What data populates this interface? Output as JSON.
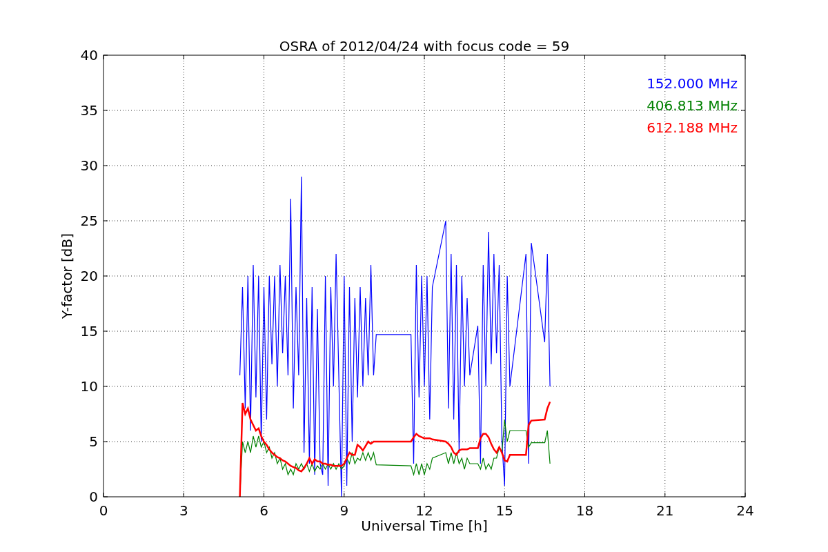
{
  "figure": {
    "chart_data": {
      "type": "line",
      "title": "OSRA of 2012/04/24 with focus code = 59",
      "xlabel": "Universal Time [h]",
      "ylabel": "Y-factor [dB]",
      "xlim": [
        0,
        24
      ],
      "ylim": [
        0,
        40
      ],
      "xticks": [
        0,
        3,
        6,
        9,
        12,
        15,
        18,
        21,
        24
      ],
      "yticks": [
        0,
        5,
        10,
        15,
        20,
        25,
        30,
        35,
        40
      ],
      "grid": true,
      "x": [
        5.1,
        5.2,
        5.3,
        5.4,
        5.5,
        5.6,
        5.7,
        5.8,
        5.9,
        6.0,
        6.1,
        6.2,
        6.3,
        6.4,
        6.5,
        6.6,
        6.7,
        6.8,
        6.9,
        7.0,
        7.1,
        7.2,
        7.3,
        7.4,
        7.5,
        7.6,
        7.7,
        7.8,
        7.9,
        8.0,
        8.1,
        8.2,
        8.3,
        8.4,
        8.5,
        8.6,
        8.7,
        8.8,
        8.9,
        9.0,
        9.1,
        9.2,
        9.3,
        9.4,
        9.5,
        9.6,
        9.7,
        9.8,
        9.9,
        10.0,
        10.1,
        10.2,
        11.5,
        11.6,
        11.7,
        11.8,
        11.9,
        12.0,
        12.1,
        12.2,
        12.3,
        12.8,
        12.9,
        13.0,
        13.1,
        13.2,
        13.3,
        13.4,
        13.5,
        13.6,
        13.7,
        14.0,
        14.1,
        14.2,
        14.3,
        14.4,
        14.5,
        14.6,
        14.7,
        14.8,
        14.9,
        15.0,
        15.1,
        15.2,
        15.8,
        15.9,
        16.0,
        16.5,
        16.6,
        16.7
      ],
      "series": [
        {
          "name": "152.000 MHz",
          "color": "#0000ff",
          "values": [
            11,
            19,
            8,
            20,
            6,
            21,
            9,
            20,
            5,
            19,
            7,
            20,
            12,
            20,
            10,
            21,
            13,
            20,
            11,
            27,
            8,
            19,
            11,
            29,
            4,
            18,
            3,
            19,
            2,
            17,
            3,
            2,
            20,
            1,
            19,
            10,
            22,
            11,
            0,
            20,
            1,
            19,
            5,
            18,
            9,
            19,
            10,
            18,
            11,
            21,
            11,
            14.7,
            14.7,
            3,
            21,
            9,
            20,
            10,
            20,
            7,
            19,
            25,
            8,
            22,
            7,
            21,
            4,
            20,
            10,
            18,
            11,
            15.5,
            3,
            21,
            10,
            24,
            12,
            22,
            13,
            21,
            5,
            1,
            20,
            10,
            22,
            3,
            23,
            14,
            22,
            10
          ]
        },
        {
          "name": "406.813 MHz",
          "color": "#008000",
          "values": [
            0,
            5,
            4,
            5,
            4,
            5.5,
            4.5,
            5.5,
            4.5,
            5,
            4,
            4.5,
            3.5,
            4,
            3,
            3.5,
            2.5,
            3,
            2,
            2.5,
            2,
            3,
            2.5,
            3,
            2.5,
            3,
            2.3,
            3,
            2.3,
            2.8,
            2.5,
            3,
            2.5,
            3,
            2.5,
            3,
            2.5,
            3,
            2.5,
            2.8,
            3.5,
            3,
            4,
            3,
            3.5,
            3.3,
            4,
            3.3,
            4,
            3.3,
            4,
            2.9,
            2.8,
            2,
            3,
            2,
            3,
            2,
            3,
            2.5,
            3.5,
            4,
            3,
            4,
            3,
            4,
            3,
            3.5,
            2.5,
            3.5,
            3,
            3,
            2.5,
            3.5,
            2.5,
            3,
            2.5,
            3.5,
            3.5,
            4.5,
            4,
            7,
            5,
            6,
            6,
            4.5,
            4.9,
            4.9,
            6,
            3
          ]
        },
        {
          "name": "612.188 MHz",
          "color": "#ff0000",
          "values": [
            0,
            8.5,
            7.5,
            8,
            7,
            6.5,
            6,
            6.2,
            5.5,
            5,
            4.7,
            4.3,
            4,
            3.8,
            3.6,
            3.5,
            3.3,
            3.2,
            3,
            2.8,
            2.7,
            2.6,
            2.4,
            2.3,
            2.6,
            3,
            3.5,
            3,
            3.4,
            3.2,
            3.2,
            3,
            3,
            2.9,
            2.9,
            2.8,
            2.8,
            2.8,
            2.8,
            3,
            3.5,
            4,
            3.8,
            3.8,
            4.7,
            4.5,
            4.2,
            4.6,
            5,
            4.8,
            5,
            5,
            5,
            5.4,
            5.7,
            5.5,
            5.4,
            5.3,
            5.3,
            5.3,
            5.2,
            5,
            4.8,
            4.5,
            4,
            3.8,
            4.2,
            4.3,
            4.3,
            4.3,
            4.4,
            4.4,
            5.3,
            5.7,
            5.7,
            5.4,
            4.8,
            4.3,
            4,
            4.5,
            4,
            3.3,
            3.2,
            3.8,
            3.8,
            6.5,
            6.9,
            7,
            8,
            8.6
          ]
        }
      ]
    }
  }
}
